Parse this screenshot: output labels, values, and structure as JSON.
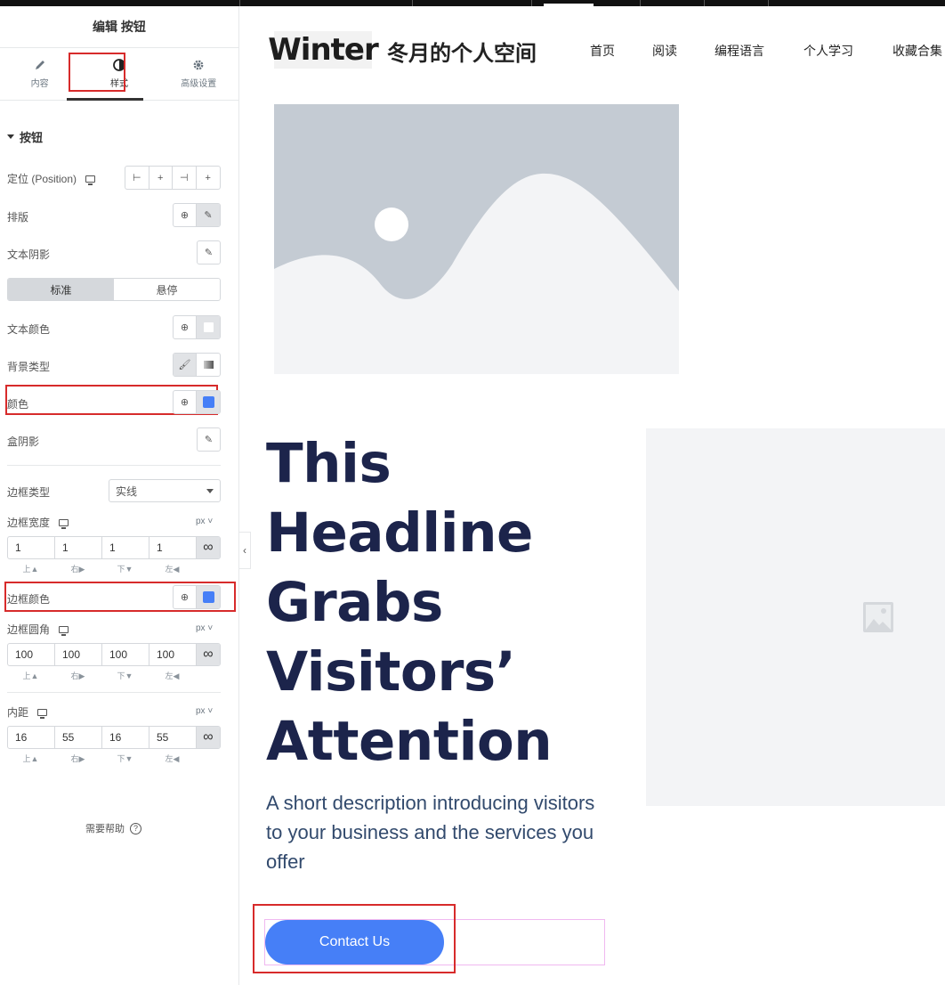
{
  "panel": {
    "title": "编辑 按钮",
    "tabs": [
      {
        "label": "内容",
        "icon": "pencil-icon"
      },
      {
        "label": "样式",
        "icon": "half-circle-icon"
      },
      {
        "label": "高级设置",
        "icon": "gear-icon"
      }
    ],
    "active_tab": "样式",
    "section_title": "按钮",
    "position_label": "定位 (Position)",
    "typography_label": "排版",
    "text_shadow_label": "文本阴影",
    "state_tabs": [
      "标准",
      "悬停"
    ],
    "active_state": "标准",
    "text_color_label": "文本颜色",
    "text_color": "#ffffff",
    "bg_type_label": "背景类型",
    "color_label": "颜色",
    "bg_color": "#467ff7",
    "box_shadow_label": "盒阴影",
    "border_type_label": "边框类型",
    "border_type_value": "实线",
    "border_width_label": "边框宽度",
    "border_width_unit": "px ˅",
    "border_width": [
      "1",
      "1",
      "1",
      "1"
    ],
    "side_labels": [
      "上▲",
      "右▶",
      "下▼",
      "左◀"
    ],
    "border_color_label": "边框颜色",
    "border_color": "#467ff7",
    "border_radius_label": "边框圆角",
    "border_radius_unit": "px ˅",
    "border_radius": [
      "100",
      "100",
      "100",
      "100"
    ],
    "padding_label": "内距",
    "padding_unit": "px ˅",
    "padding": [
      "16",
      "55",
      "16",
      "55"
    ],
    "help_label": "需要帮助",
    "help_icon": "?"
  },
  "site": {
    "logo_text": "Winter",
    "title": "冬月的个人空间",
    "nav": [
      "首页",
      "阅读",
      "编程语言",
      "个人学习",
      "收藏合集"
    ]
  },
  "hero": {
    "headline": [
      "This",
      "Headline",
      "Grabs",
      "Visitors’",
      "Attention"
    ],
    "description": "A short description introducing visitors to your business and the services you offer",
    "button_label": "Contact Us"
  }
}
